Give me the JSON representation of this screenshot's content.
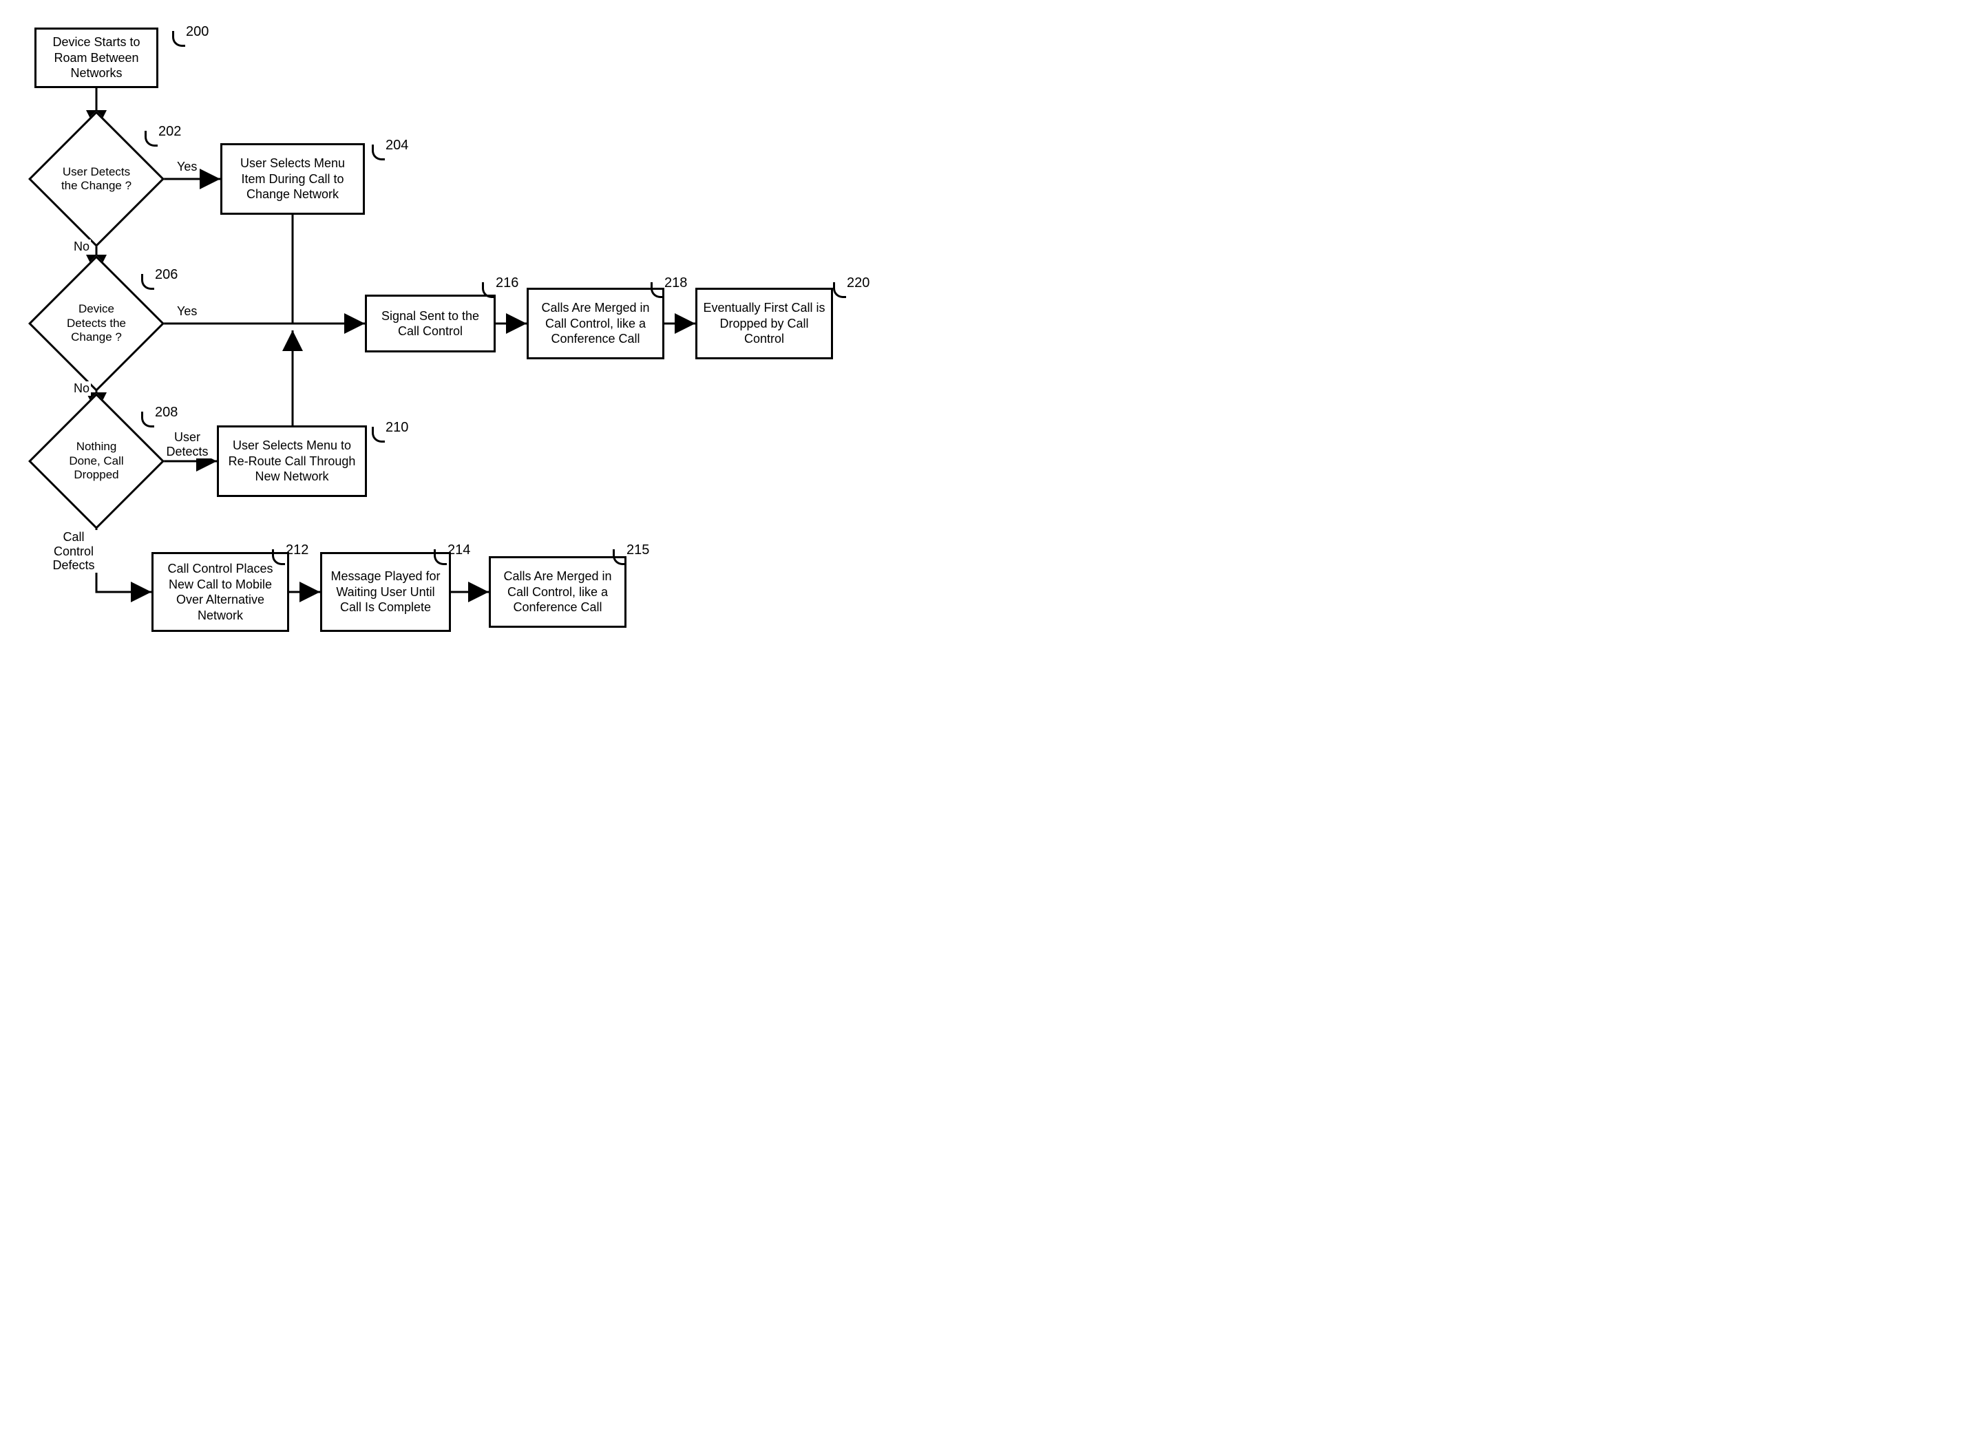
{
  "nodes": {
    "n200": {
      "text": "Device Starts to Roam Between Networks",
      "ref": "200"
    },
    "n202": {
      "text": "User Detects the Change ?",
      "ref": "202"
    },
    "n204": {
      "text": "User Selects Menu Item During Call to Change Network",
      "ref": "204"
    },
    "n206": {
      "text": "Device Detects the Change ?",
      "ref": "206"
    },
    "n208": {
      "text": "Nothing Done, Call Dropped",
      "ref": "208"
    },
    "n210": {
      "text": "User Selects Menu to Re-Route Call Through New Network",
      "ref": "210"
    },
    "n212": {
      "text": "Call Control Places New Call to Mobile Over Alternative Network",
      "ref": "212"
    },
    "n214": {
      "text": "Message Played for Waiting User Until Call Is Complete",
      "ref": "214"
    },
    "n215": {
      "text": "Calls Are Merged in Call Control, like a Conference Call",
      "ref": "215"
    },
    "n216": {
      "text": "Signal Sent to the Call Control",
      "ref": "216"
    },
    "n218": {
      "text": "Calls Are Merged in Call Control, like a Conference Call",
      "ref": "218"
    },
    "n220": {
      "text": "Eventually First Call is Dropped by Call Control",
      "ref": "220"
    }
  },
  "edgeLabels": {
    "yes202": "Yes",
    "no202": "No",
    "yes206": "Yes",
    "no206": "No",
    "userDetects208": "User Detects",
    "callControlDefects208": "Call Control Defects"
  }
}
